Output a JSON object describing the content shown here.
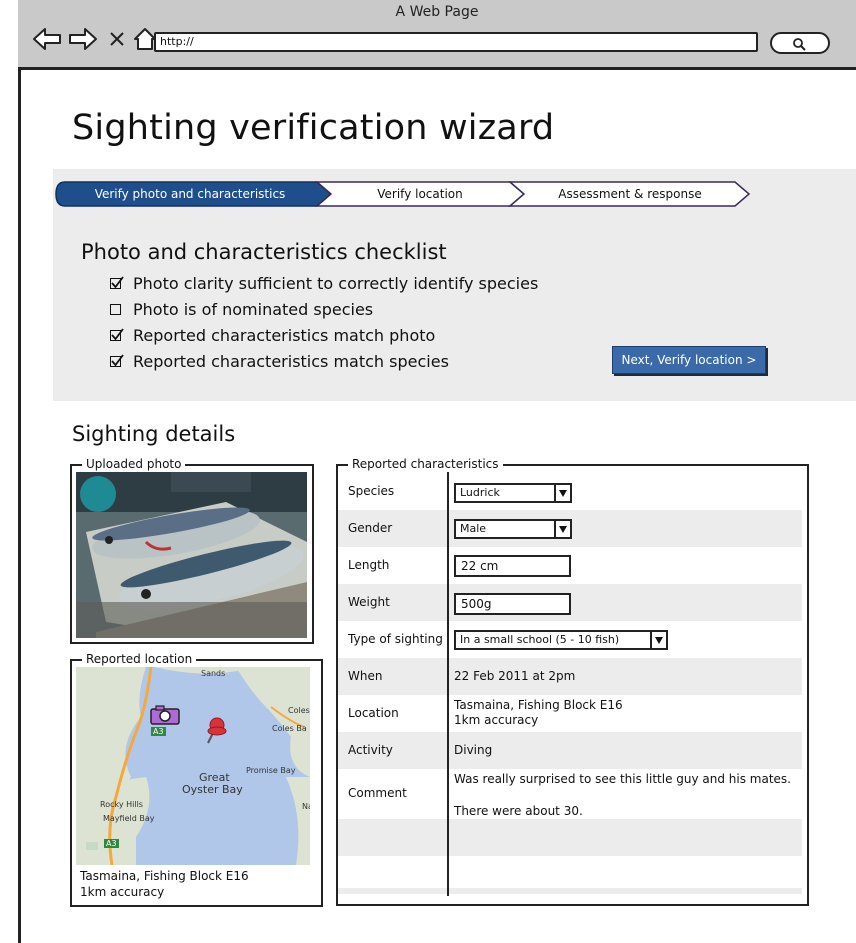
{
  "window": {
    "title": "A Web Page",
    "url": "http://"
  },
  "page": {
    "title": "Sighting verification wizard"
  },
  "wizard": {
    "steps": [
      {
        "label": "Verify photo and characteristics",
        "active": true
      },
      {
        "label": "Verify location",
        "active": false
      },
      {
        "label": "Assessment & response",
        "active": false
      }
    ]
  },
  "checklist": {
    "title": "Photo and characteristics checklist",
    "items": [
      {
        "label": "Photo clarity sufficient to correctly identify species",
        "checked": true
      },
      {
        "label": "Photo is of nominated species",
        "checked": false
      },
      {
        "label": "Reported characteristics match photo",
        "checked": true
      },
      {
        "label": "Reported characteristics match species",
        "checked": true
      }
    ],
    "next_button": "Next, Verify location >"
  },
  "details": {
    "title": "Sighting details",
    "photo_legend": "Uploaded photo",
    "location_legend": "Reported location",
    "location_caption_line1": "Tasmaina, Fishing Block E16",
    "location_caption_line2": "1km accuracy",
    "map_labels": {
      "sands": "Sands",
      "coles": "Coles",
      "coles_bay": "Coles Ba",
      "great": "Great",
      "oyster_bay": "Oyster Bay",
      "promise_bay": "Promise Bay",
      "rocky_hills": "Rocky Hills",
      "mayfield_bay": "Mayfield Bay",
      "na": "Na",
      "a3_top": "A3",
      "a3_bottom": "A3"
    }
  },
  "characteristics": {
    "legend": "Reported characteristics",
    "species_label": "Species",
    "species_value": "Ludrick",
    "gender_label": "Gender",
    "gender_value": "Male",
    "length_label": "Length",
    "length_value": "22 cm",
    "weight_label": "Weight",
    "weight_value": "500g",
    "type_label": "Type of sighting",
    "type_value": "In a small school (5 - 10 fish)",
    "when_label": "When",
    "when_value": "22 Feb 2011 at 2pm",
    "location_label": "Location",
    "location_value_line1": "Tasmaina, Fishing Block E16",
    "location_value_line2": "1km accuracy",
    "activity_label": "Activity",
    "activity_value": "Diving",
    "comment_label": "Comment",
    "comment_line1": "Was really surprised to see this little guy and his mates.",
    "comment_line2": "There were about 30."
  },
  "colors": {
    "accent": "#1f4e8c",
    "button": "#3a6aa8",
    "panel": "#ececec",
    "water": "#b1c7e9",
    "land": "#dde3d3",
    "pin": "#d9333a"
  },
  "icons": [
    "back-arrow-icon",
    "forward-arrow-icon",
    "close-icon",
    "home-icon",
    "search-icon",
    "chevron-down-icon",
    "checkbox-icon",
    "map-pin-icon",
    "camera-icon"
  ]
}
